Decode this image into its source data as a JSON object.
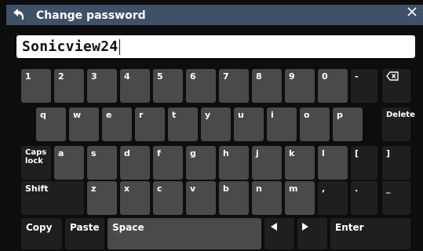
{
  "dialog": {
    "title": "Change password",
    "password_value": "Sonicview24"
  },
  "icons": {
    "back": "back-arrow-icon",
    "close": "close-icon",
    "backspace": "backspace-icon",
    "left": "left-arrow-icon",
    "right": "right-arrow-icon"
  },
  "keyboard": {
    "row1": [
      "1",
      "2",
      "3",
      "4",
      "5",
      "6",
      "7",
      "8",
      "9",
      "0",
      "-"
    ],
    "row2": [
      "q",
      "w",
      "e",
      "r",
      "t",
      "y",
      "u",
      "i",
      "o",
      "p"
    ],
    "delete": "Delete",
    "caps_line1": "Caps",
    "caps_line2": "lock",
    "row3": [
      "a",
      "s",
      "d",
      "f",
      "g",
      "h",
      "j",
      "k",
      "l",
      "[",
      "]"
    ],
    "shift": "Shift",
    "row4": [
      "z",
      "x",
      "c",
      "v",
      "b",
      "n",
      "m",
      ",",
      ".",
      "_"
    ],
    "copy": "Copy",
    "paste": "Paste",
    "space": "Space",
    "enter": "Enter"
  },
  "colors": {
    "titlebar": "#3e5166",
    "key": "#4a4a4a",
    "key_dark": "#1f1f1f",
    "background": "#0d0d0d"
  }
}
